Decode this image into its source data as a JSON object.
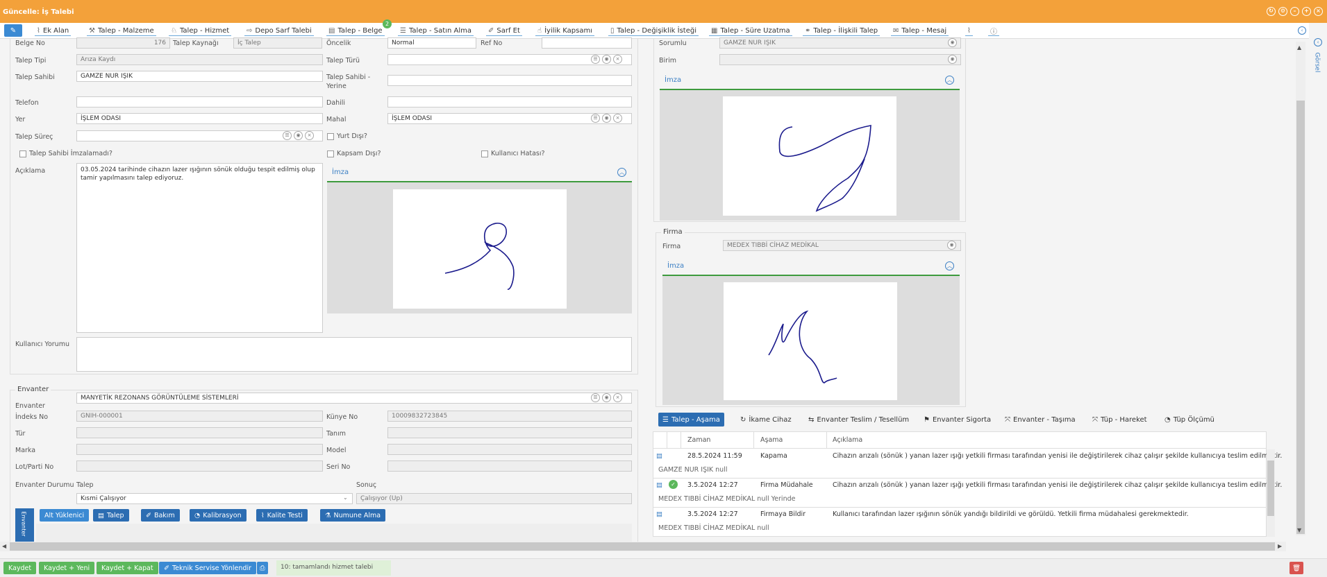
{
  "window": {
    "title": "Güncelle: İş Talebi"
  },
  "tabs": [
    {
      "label": "Ek Alan",
      "icon": "paperclip-icon"
    },
    {
      "label": "Talep - Malzeme",
      "icon": "tools-icon"
    },
    {
      "label": "Talep - Hizmet",
      "icon": "service-icon"
    },
    {
      "label": "Depo Sarf Talebi",
      "icon": "export-icon"
    },
    {
      "label": "Talep - Belge",
      "icon": "document-icon",
      "badge": "2"
    },
    {
      "label": "Talep - Satın Alma",
      "icon": "list-icon"
    },
    {
      "label": "Sarf Et",
      "icon": "wrench-icon"
    },
    {
      "label": "İyilik Kapsamı",
      "icon": "thumbs-up-icon"
    },
    {
      "label": "Talep - Değişiklik İsteği",
      "icon": "mobile-icon"
    },
    {
      "label": "Talep - Süre Uzatma",
      "icon": "calendar-icon"
    },
    {
      "label": "Talep - İlişkili Talep",
      "icon": "link-icon"
    },
    {
      "label": "Talep - Mesaj",
      "icon": "chat-icon"
    }
  ],
  "form": {
    "belge_no_label": "Belge No",
    "belge_no_value": "176",
    "talep_kaynagi_label": "Talep Kaynağı",
    "talep_kaynagi_value": "İç Talep",
    "oncelik_label": "Öncelik",
    "oncelik_value": "Normal",
    "ref_no_label": "Ref No",
    "talep_tipi_label": "Talep Tipi",
    "talep_tipi_value": "Arıza Kaydı",
    "talep_turu_label": "Talep Türü",
    "talep_sahibi_label": "Talep Sahibi",
    "talep_sahibi_value": "GAMZE NUR IŞIK",
    "talep_sahibi_yerine_label_1": "Talep Sahibi -",
    "talep_sahibi_yerine_label_2": "Yerine",
    "telefon_label": "Telefon",
    "dahili_label": "Dahili",
    "yer_label": "Yer",
    "yer_value": "İŞLEM ODASI",
    "mahal_label": "Mahal",
    "mahal_value": "İŞLEM ODASI",
    "talep_surec_label": "Talep Süreç",
    "yurt_disi_label": "Yurt Dışı?",
    "talep_sahibi_imzalamadi_label": "Talep Sahibi İmzalamadı?",
    "kapsam_disi_label": "Kapsam Dışı?",
    "kullanici_hatasi_label": "Kullanıcı Hatası?",
    "aciklama_label": "Açıklama",
    "aciklama_value": "03.05.2024 tarihinde cihazın lazer ışığının sönük olduğu tespit edilmiş olup tamir yapılmasını talep ediyoruz.",
    "imza_label": "İmza",
    "kullanici_yorumu_label": "Kullanıcı Yorumu"
  },
  "right": {
    "sorumlu_label": "Sorumlu",
    "sorumlu_value": "GAMZE NUR IŞIK",
    "birim_label": "Birim",
    "imza_label": "İmza",
    "firma_legend": "Firma",
    "firma_label": "Firma",
    "firma_value": "MEDEX TIBBİ CİHAZ MEDİKAL",
    "firma_imza_label": "İmza",
    "side_label": "Görsel"
  },
  "envanter": {
    "legend": "Envanter",
    "envanter_label": "Envanter",
    "envanter_value": "MANYETİK REZONANS GÖRÜNTÜLEME SİSTEMLERİ",
    "indeks_no_label": "İndeks No",
    "indeks_no_value": "GNIH-000001",
    "kunye_no_label": "Künye No",
    "kunye_no_value": "10009832723845",
    "tur_label": "Tür",
    "tanim_label": "Tanım",
    "marka_label": "Marka",
    "model_label": "Model",
    "lot_label": "Lot/Parti No",
    "seri_label": "Seri No",
    "durum_label": "Envanter Durumu",
    "talep_label": "Talep",
    "sonuc_label": "Sonuç",
    "talep_value": "Kısmi Çalışıyor",
    "sonuc_value": "Çalışıyor (Up)",
    "vertical_tab": "Envanter",
    "buttons": [
      "Alt Yüklenici",
      "Talep",
      "Bakım",
      "Kalibrasyon",
      "Kalite Testi",
      "Numune Alma"
    ]
  },
  "grid": {
    "tabs": [
      "Talep - Aşama",
      "İkame Cihaz",
      "Envanter Teslim / Tesellüm",
      "Envanter Sigorta",
      "Envanter - Taşıma",
      "Tüp - Hareket",
      "Tüp Ölçümü"
    ],
    "headers": [
      "Zaman",
      "Aşama",
      "Açıklama"
    ],
    "rows": [
      {
        "zaman": "28.5.2024 11:59",
        "asama": "Kapama",
        "aciklama": "Cihazın arızalı (sönük ) yanan lazer ışığı yetkili firması tarafından yenisi ile değiştirilerek cihaz çalışır şekilde kullanıcıya teslim edilmiştir.",
        "sub": "GAMZE NUR IŞIK  null"
      },
      {
        "zaman": "3.5.2024 12:27",
        "asama": "Firma Müdahale",
        "aciklama": "Cihazın arızalı (sönük ) yanan lazer ışığı yetkili firması tarafından yenisi ile değiştirilerek cihaz çalışır şekilde kullanıcıya teslim edilmiştir.",
        "sub": "MEDEX TIBBİ CİHAZ MEDİKAL  null  Yerinde"
      },
      {
        "zaman": "3.5.2024 12:27",
        "asama": "Firmaya Bildir",
        "aciklama": "Kullanıcı tarafından lazer ışığının sönük yandığı bildirildi ve görüldü. Yetkili firma müdahalesi gerekmektedir.",
        "sub": "MEDEX TIBBİ CİHAZ MEDİKAL  null"
      }
    ]
  },
  "bottom": {
    "kaydet": "Kaydet",
    "kaydet_yeni": "Kaydet + Yeni",
    "kaydet_kapat": "Kaydet + Kapat",
    "teknik": "Teknik Servise Yönlendir",
    "status": "10: tamamlandı hizmet talebi"
  },
  "colors": {
    "titlebar": "#f3a13a",
    "accent": "#2c6db2",
    "green": "#5cb85c",
    "signature": "#1a1a8c"
  }
}
